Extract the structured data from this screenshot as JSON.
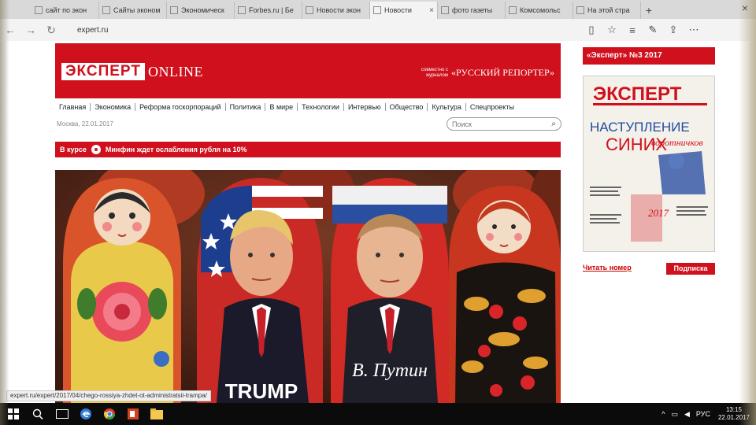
{
  "browser": {
    "tabs": [
      {
        "title": "сайт по экон",
        "active": false
      },
      {
        "title": "Сайты эконом",
        "active": false
      },
      {
        "title": "Экономическ",
        "active": false
      },
      {
        "title": "Forbes.ru | Бе",
        "active": false
      },
      {
        "title": "Новости экон",
        "active": false
      },
      {
        "title": "Новости",
        "active": true
      },
      {
        "title": "фото газеты",
        "active": false
      },
      {
        "title": "Комсомольс",
        "active": false
      },
      {
        "title": "На этой стра",
        "active": false
      }
    ],
    "new_tab_label": "+",
    "close_label": "×",
    "address": "expert.ru"
  },
  "site": {
    "logo_main": "ЭКСПЕРТ",
    "logo_sub": "ONLINE",
    "partner_small": "совместно с журналом",
    "partner_name": "«РУССКИЙ РЕПОРТЕР»",
    "menu": [
      "Главная",
      "Экономика",
      "Реформа госкорпораций",
      "Политика",
      "В мире",
      "Технологии",
      "Интервью",
      "Общество",
      "Культура",
      "Спецпроекты"
    ],
    "date": "Москва, 22.01.2017",
    "search_placeholder": "Поиск",
    "breaking_label": "В курсе",
    "breaking_text": "Минфин ждет ослабления рубля на 10%",
    "photo_caption": "В. Путин",
    "photo_caption2": "TRUMP"
  },
  "sidebar": {
    "issue_title": "«Эксперт» №3 2017",
    "cover_logo": "ЭКСПЕРТ",
    "cover_headline1": "НАСТУПЛЕНИЕ",
    "cover_headline2": "СИНИХ",
    "cover_handwritten": "воротничков",
    "read_link": "Читать номер",
    "subscribe": "Подписка"
  },
  "status_url": "expert.ru/expert/2017/04/chego-rossiya-zhdet-ot-administratsii-trampa/",
  "taskbar": {
    "lang": "РУС",
    "time": "13:15",
    "date": "22.01.2017"
  },
  "colors": {
    "brand_red": "#d0101c",
    "taskbar": "#0b0b0b"
  }
}
